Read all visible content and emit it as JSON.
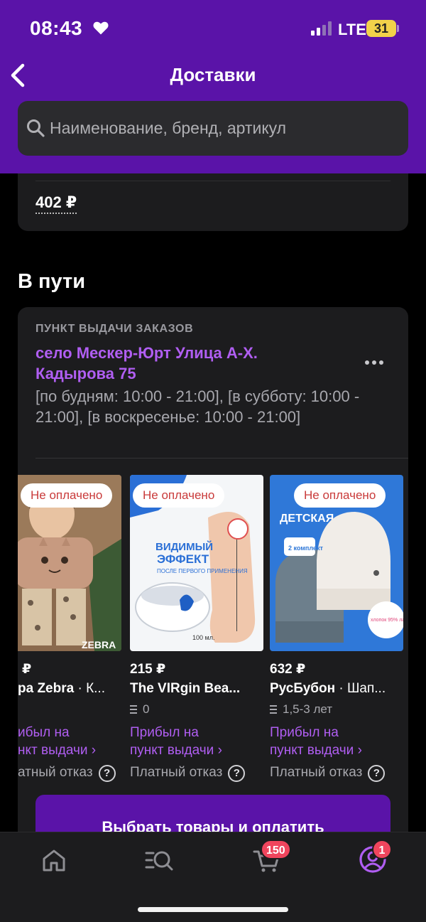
{
  "status_bar": {
    "time": "08:43",
    "network": "LTE",
    "battery": "31"
  },
  "nav": {
    "title": "Доставки"
  },
  "search": {
    "placeholder": "Наименование, бренд, артикул"
  },
  "previous_order": {
    "price": "402 ₽"
  },
  "section": {
    "title": "В пути"
  },
  "pickup": {
    "label": "ПУНКТ ВЫДАЧИ ЗАКАЗОВ",
    "address": "село Мескер-Юрт Улица А-Х. Кадырова 75",
    "hours": "[по будням: 10:00 - 21:00], [в субботу: 10:00 - 21:00], [в воскресенье: 10:00 - 21:00]"
  },
  "products": [
    {
      "badge": "Не оплачено",
      "price": "₽",
      "brand": "ра Zebra",
      "name": " · К...",
      "size": "",
      "status_1": "ибыл на",
      "status_2": "нкт выдачи ›",
      "refusal": "атный отказ"
    },
    {
      "badge": "Не оплачено",
      "price": "215 ₽",
      "brand": "The VIRgin Bea...",
      "name": "",
      "size": "0",
      "status_1": "Прибыл на",
      "status_2": "пункт выдачи ›",
      "refusal": "Платный отказ"
    },
    {
      "badge": "Не оплачено",
      "price": "632 ₽",
      "brand": "РусБубон",
      "name": " · Шап...",
      "size": "1,5-3 лет",
      "status_1": "Прибыл на",
      "status_2": "пункт выдачи ›",
      "refusal": "Платный отказ"
    }
  ],
  "product_images": {
    "p2_text_1": "ВИДИМЫЙ",
    "p2_text_2": "ЭФФЕКТ",
    "p2_text_3": "ПОСЛЕ ПЕРВОГО ПРИМЕНЕНИЯ",
    "p2_text_4": "100 мл.",
    "p3_text_1": "ДЕТСКАЯ",
    "p3_text_2": "2 комплект",
    "p3_text_3": "хлопок 95% лайкра 5%",
    "p1_text_1": "ZEBRA"
  },
  "actions": {
    "pay_button": "Выбрать товары и оплатить"
  },
  "tabbar": {
    "cart_badge": "150",
    "profile_badge": "1"
  },
  "colors": {
    "header": "#5a13a8",
    "accent": "#b05ef2",
    "card": "#1c1c1e",
    "badge": "#f0455d"
  }
}
